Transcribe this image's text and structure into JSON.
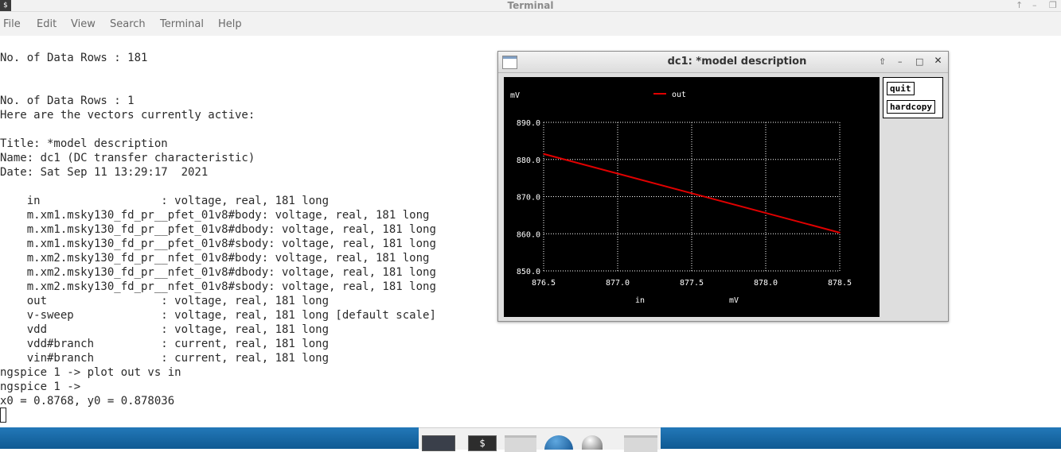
{
  "window": {
    "title": "Terminal",
    "controls": [
      "↑",
      "–",
      "❐"
    ],
    "icon": "terminal-icon"
  },
  "menubar": {
    "items": [
      "File",
      "Edit",
      "View",
      "Search",
      "Terminal",
      "Help"
    ]
  },
  "terminal": {
    "lines": [
      "No. of Data Rows : 181",
      "",
      "",
      "No. of Data Rows : 1",
      "Here are the vectors currently active:",
      "",
      "Title: *model description",
      "Name: dc1 (DC transfer characteristic)",
      "Date: Sat Sep 11 13:29:17  2021",
      "",
      "    in                  : voltage, real, 181 long",
      "    m.xm1.msky130_fd_pr__pfet_01v8#body: voltage, real, 181 long",
      "    m.xm1.msky130_fd_pr__pfet_01v8#dbody: voltage, real, 181 long",
      "    m.xm1.msky130_fd_pr__pfet_01v8#sbody: voltage, real, 181 long",
      "    m.xm2.msky130_fd_pr__nfet_01v8#body: voltage, real, 181 long",
      "    m.xm2.msky130_fd_pr__nfet_01v8#dbody: voltage, real, 181 long",
      "    m.xm2.msky130_fd_pr__nfet_01v8#sbody: voltage, real, 181 long",
      "    out                 : voltage, real, 181 long",
      "    v-sweep             : voltage, real, 181 long [default scale]",
      "    vdd                 : voltage, real, 181 long",
      "    vdd#branch          : current, real, 181 long",
      "    vin#branch          : current, real, 181 long",
      "ngspice 1 -> plot out vs in",
      "ngspice 1 ->",
      "x0 = 0.8768, y0 = 0.878036"
    ]
  },
  "plot_window": {
    "title": "dc1: *model description",
    "controls": [
      "⇧",
      "–",
      "□",
      "✕"
    ],
    "buttons": {
      "quit": "quit",
      "hardcopy": "hardcopy"
    }
  },
  "chart_data": {
    "type": "line",
    "ylabel_unit": "mV",
    "xlabel": "in",
    "xlabel_unit": "mV",
    "xlim": [
      876.5,
      878.5
    ],
    "ylim": [
      850.0,
      890.0
    ],
    "xticks": [
      "876.5",
      "877.0",
      "877.5",
      "878.0",
      "878.5"
    ],
    "yticks": [
      "890.0",
      "880.0",
      "870.0",
      "860.0",
      "850.0"
    ],
    "grid": true,
    "legend_position": "top-center",
    "series": [
      {
        "name": "out",
        "color": "#e00000",
        "x": [
          876.5,
          877.0,
          877.5,
          878.0,
          878.5
        ],
        "y": [
          881.5,
          876.2,
          870.9,
          865.6,
          860.3
        ]
      }
    ]
  },
  "taskbar": {
    "items": [
      "window-thumbnail",
      "terminal-launcher-icon",
      "folder-icon",
      "browser-globe-icon",
      "disc-icon",
      "folder-icon"
    ]
  }
}
